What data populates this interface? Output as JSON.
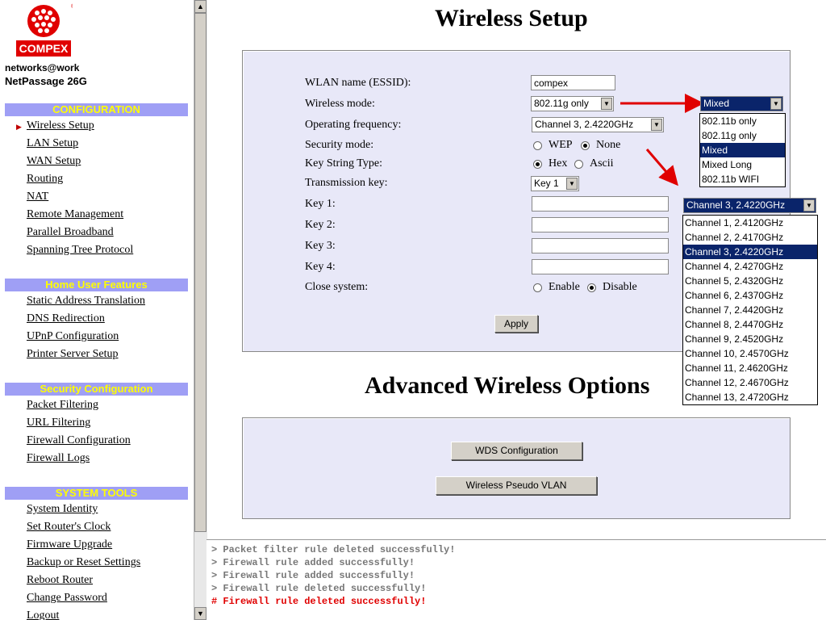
{
  "brand": {
    "logo_text": "COMPEX",
    "tagline": "networks@work",
    "product": "NetPassage 26G"
  },
  "sidebar": {
    "configuration": {
      "title": "CONFIGURATION",
      "items": [
        "Wireless Setup",
        "LAN Setup",
        "WAN Setup",
        "Routing",
        "NAT",
        "Remote Management",
        "Parallel Broadband",
        "Spanning Tree Protocol"
      ],
      "active": "Wireless Setup"
    },
    "home": {
      "title": "Home User Features",
      "items": [
        "Static Address Translation",
        "DNS Redirection",
        "UPnP Configuration",
        "Printer Server Setup"
      ]
    },
    "security": {
      "title": "Security Configuration",
      "items": [
        "Packet Filtering",
        "URL Filtering",
        "Firewall Configuration",
        "Firewall Logs"
      ]
    },
    "tools": {
      "title": "SYSTEM TOOLS",
      "items": [
        "System Identity",
        "Set Router's Clock",
        "Firmware Upgrade",
        "Backup or Reset Settings",
        "Reboot Router",
        "Change Password",
        "Logout"
      ]
    }
  },
  "page": {
    "title": "Wireless Setup",
    "advanced_title": "Advanced Wireless Options"
  },
  "form": {
    "essid_label": "WLAN name (ESSID):",
    "essid_value": "compex",
    "mode_label": "Wireless mode:",
    "mode_value": "802.11g only",
    "freq_label": "Operating frequency:",
    "freq_value": "Channel 3, 2.4220GHz",
    "security_label": "Security mode:",
    "security_wep": "WEP",
    "security_none": "None",
    "keytype_label": "Key String Type:",
    "keytype_hex": "Hex",
    "keytype_ascii": "Ascii",
    "txkey_label": "Transmission key:",
    "txkey_value": "Key 1",
    "key1_label": "Key 1:",
    "key2_label": "Key 2:",
    "key3_label": "Key 3:",
    "key4_label": "Key 4:",
    "close_label": "Close system:",
    "close_enable": "Enable",
    "close_disable": "Disable",
    "apply": "Apply"
  },
  "advanced": {
    "wds": "WDS Configuration",
    "vlan": "Wireless Pseudo VLAN"
  },
  "mode_dropdown": {
    "value": "Mixed",
    "options": [
      "802.11b only",
      "802.11g only",
      "Mixed",
      "Mixed Long",
      "802.11b WIFI"
    ],
    "selected_index": 2
  },
  "channel_dropdown": {
    "value": "Channel 3, 2.4220GHz",
    "options": [
      "Channel 1, 2.4120GHz",
      "Channel 2, 2.4170GHz",
      "Channel 3, 2.4220GHz",
      "Channel 4, 2.4270GHz",
      "Channel 5, 2.4320GHz",
      "Channel 6, 2.4370GHz",
      "Channel 7, 2.4420GHz",
      "Channel 8, 2.4470GHz",
      "Channel 9, 2.4520GHz",
      "Channel 10, 2.4570GHz",
      "Channel 11, 2.4620GHz",
      "Channel 12, 2.4670GHz",
      "Channel 13, 2.4720GHz"
    ],
    "selected_index": 2
  },
  "log": [
    {
      "text": "> Packet filter rule deleted successfully!",
      "error": false
    },
    {
      "text": "> Firewall rule added successfully!",
      "error": false
    },
    {
      "text": "> Firewall rule added successfully!",
      "error": false
    },
    {
      "text": "> Firewall rule deleted successfully!",
      "error": false
    },
    {
      "text": "# Firewall rule deleted successfully!",
      "error": true
    }
  ],
  "colors": {
    "section_bg": "#9f9ff5",
    "section_text": "#ffff00",
    "panel_bg": "#e8e8f8",
    "highlight": "#0a246a",
    "arrow": "#e00000"
  }
}
